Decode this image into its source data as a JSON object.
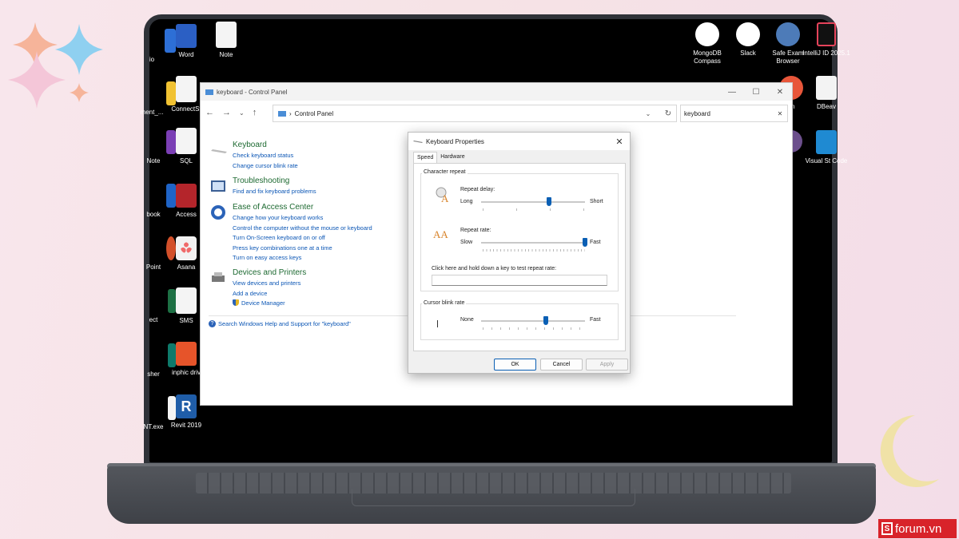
{
  "desktop": {
    "icons": [
      {
        "label": "io"
      },
      {
        "label": "Word"
      },
      {
        "label": "Note"
      },
      {
        "label": "ment_..."
      },
      {
        "label": "ConnectSt"
      },
      {
        "label": "Note"
      },
      {
        "label": "SQL"
      },
      {
        "label": "book"
      },
      {
        "label": "Access"
      },
      {
        "label": "Point"
      },
      {
        "label": "Asana"
      },
      {
        "label": "ect"
      },
      {
        "label": "SMS"
      },
      {
        "label": "sher"
      },
      {
        "label": "inphic driv"
      },
      {
        "label": "NT.exe"
      },
      {
        "label": "Revit 2019"
      },
      {
        "label": "MongoDB Compass"
      },
      {
        "label": "Slack"
      },
      {
        "label": "Safe Exam Browser"
      },
      {
        "label": "IntelliJ ID 2025.1"
      },
      {
        "label": "an"
      },
      {
        "label": "DBeav"
      },
      {
        "label": "o"
      },
      {
        "label": "Visual St Code"
      }
    ]
  },
  "cp_window": {
    "title": "keyboard - Control Panel",
    "address": "Control Panel",
    "search_value": "keyboard",
    "sections": [
      {
        "heading": "Keyboard",
        "links": [
          "Check keyboard status",
          "Change cursor blink rate"
        ]
      },
      {
        "heading": "Troubleshooting",
        "links": [
          "Find and fix keyboard problems"
        ]
      },
      {
        "heading": "Ease of Access Center",
        "links": [
          "Change how your keyboard works",
          "Control the computer without the mouse or keyboard",
          "Turn On-Screen keyboard on or off",
          "Press key combinations one at a time",
          "Turn on easy access keys"
        ]
      },
      {
        "heading": "Devices and Printers",
        "links": [
          "View devices and printers",
          "Add a device",
          "Device Manager"
        ]
      }
    ],
    "help_link": "Search Windows Help and Support for \"keyboard\""
  },
  "kp_dialog": {
    "title": "Keyboard Properties",
    "tabs": [
      "Speed",
      "Hardware"
    ],
    "character_repeat": {
      "group_label": "Character repeat",
      "repeat_delay": {
        "label": "Repeat delay:",
        "left": "Long",
        "right": "Short",
        "value_fraction": 0.65
      },
      "repeat_rate": {
        "label": "Repeat rate:",
        "left": "Slow",
        "right": "Fast",
        "value_fraction": 1.0
      },
      "test_label": "Click here and hold down a key to test repeat rate:"
    },
    "cursor_blink": {
      "group_label": "Cursor blink rate",
      "left": "None",
      "right": "Fast",
      "value_fraction": 0.62
    },
    "buttons": {
      "ok": "OK",
      "cancel": "Cancel",
      "apply": "Apply"
    }
  },
  "watermark": {
    "letter": "S",
    "text": "forum.vn"
  },
  "colors": {
    "link": "#0b56b5",
    "heading": "#1e6a32",
    "slider": "#0a5fb4",
    "brand_red": "#d8232a"
  }
}
